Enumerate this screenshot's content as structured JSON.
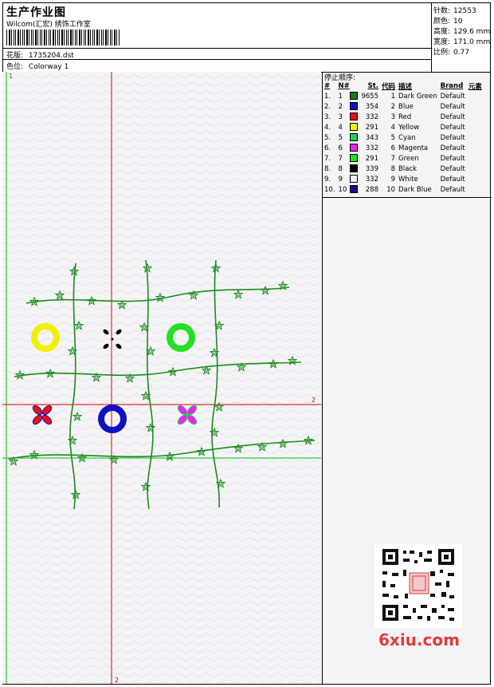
{
  "header": {
    "title": "生产作业图",
    "company": "Wilcom(汇宏) 绣饰工作室",
    "design_label": "花版:",
    "design_value": "1735204.dst",
    "colorway_label": "色位:",
    "colorway_value": "Colorway 1"
  },
  "stats": [
    {
      "label": "针数:",
      "value": "12553"
    },
    {
      "label": "颜色:",
      "value": "10"
    },
    {
      "label": "高度:",
      "value": "129.6 mm"
    },
    {
      "label": "宽度:",
      "value": "171.0 mm"
    },
    {
      "label": "比例:",
      "value": "0.77"
    }
  ],
  "panel": {
    "stop_title": "停止顺序:",
    "columns": [
      "#",
      "N#",
      "St.",
      "代码",
      "描述",
      "Brand",
      "元素"
    ],
    "rows": [
      {
        "idx": "1.",
        "n": "1",
        "color": "#108010",
        "st": "9655",
        "code": "1",
        "desc": "Dark Green",
        "brand": "Default"
      },
      {
        "idx": "2.",
        "n": "2",
        "color": "#1010c0",
        "st": "354",
        "code": "2",
        "desc": "Blue",
        "brand": "Default"
      },
      {
        "idx": "3.",
        "n": "3",
        "color": "#e81010",
        "st": "332",
        "code": "3",
        "desc": "Red",
        "brand": "Default"
      },
      {
        "idx": "4.",
        "n": "4",
        "color": "#f0f000",
        "st": "291",
        "code": "4",
        "desc": "Yellow",
        "brand": "Default"
      },
      {
        "idx": "5.",
        "n": "5",
        "color": "#20d060",
        "st": "343",
        "code": "5",
        "desc": "Cyan",
        "brand": "Default"
      },
      {
        "idx": "6.",
        "n": "6",
        "color": "#f020f0",
        "st": "332",
        "code": "6",
        "desc": "Magenta",
        "brand": "Default"
      },
      {
        "idx": "7.",
        "n": "7",
        "color": "#20e020",
        "st": "291",
        "code": "7",
        "desc": "Green",
        "brand": "Default"
      },
      {
        "idx": "8.",
        "n": "8",
        "color": "#000000",
        "st": "339",
        "code": "8",
        "desc": "Black",
        "brand": "Default"
      },
      {
        "idx": "9.",
        "n": "9",
        "color": "#f0f0f0",
        "st": "332",
        "code": "9",
        "desc": "White",
        "brand": "Default"
      },
      {
        "idx": "10.",
        "n": "10",
        "color": "#101090",
        "st": "288",
        "code": "10",
        "desc": "Dark Blue",
        "brand": "Default"
      }
    ]
  },
  "canvas": {
    "marker_1_top": "1",
    "marker_2_right": "2",
    "marker_2_bottom": "2",
    "colors": {
      "vine": "#1a8c1a",
      "guide_red": "#e00000",
      "guide_green": "#00c000"
    }
  },
  "watermark": {
    "logo_text": "6xiu.com"
  }
}
